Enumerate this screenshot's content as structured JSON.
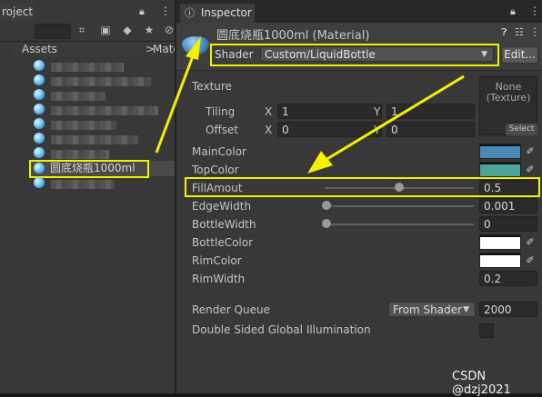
{
  "project_panel": {
    "tab_label": "roject",
    "breadcrumb": {
      "root": "Assets",
      "sep": ">",
      "tail": "Mate"
    },
    "selected_file": "圆底烧瓶1000ml"
  },
  "inspector": {
    "tab_label": "Inspector",
    "material_title": "圆底烧瓶1000ml (Material)",
    "shader_label": "Shader",
    "shader_value": "Custom/LiquidBottle",
    "edit_button": "Edit...",
    "texture": {
      "label": "Texture",
      "tiling_label": "Tiling",
      "offset_label": "Offset",
      "x_label": "X",
      "y_label": "Y",
      "tiling_x": "1",
      "tiling_y": "1",
      "offset_x": "0",
      "offset_y": "0",
      "none_text": "None",
      "none_subtext": "(Texture)",
      "select_button": "Select"
    },
    "properties": {
      "main_color": {
        "label": "MainColor",
        "color": "#4a88b8"
      },
      "top_color": {
        "label": "TopColor",
        "color": "#4da39a"
      },
      "fill_amount": {
        "label": "FillAmout",
        "value": "0.5",
        "fraction": 0.5
      },
      "edge_width": {
        "label": "EdgeWidth",
        "value": "0.001",
        "fraction": 0.0
      },
      "bottle_width": {
        "label": "BottleWidth",
        "value": "0",
        "fraction": 0.0
      },
      "bottle_color": {
        "label": "BottleColor",
        "color": "#ffffff"
      },
      "rim_color": {
        "label": "RimColor",
        "color": "#ffffff"
      },
      "rim_width": {
        "label": "RimWidth",
        "value": "0.2"
      }
    },
    "render_queue": {
      "label": "Render Queue",
      "mode": "From Shader",
      "value": "2000"
    },
    "double_sided": {
      "label": "Double Sided Global Illumination"
    }
  },
  "watermark": "CSDN @dzj2021",
  "colors": {
    "highlight": "#f5f000",
    "accent": "#4a88b8"
  }
}
